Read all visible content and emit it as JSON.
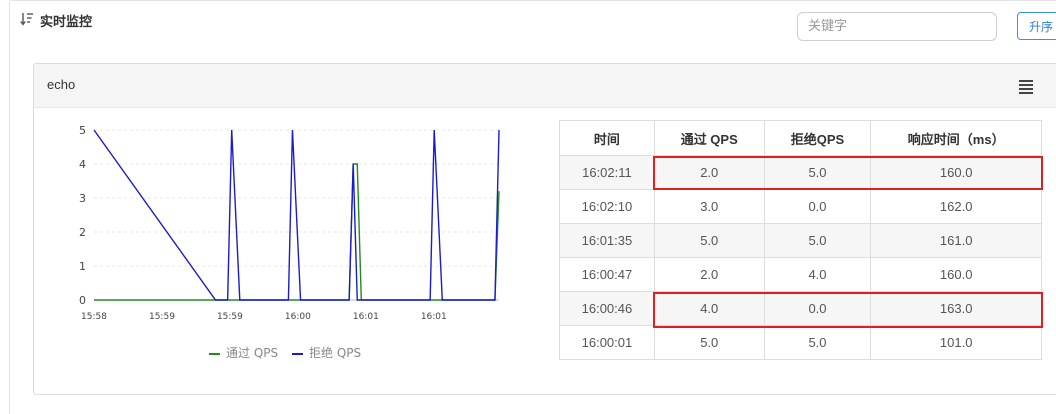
{
  "header": {
    "title": "实时监控",
    "sort_icon": "sort-descending-icon"
  },
  "search": {
    "placeholder": "关键字"
  },
  "sort_button": {
    "label": "升序"
  },
  "card": {
    "title": "echo",
    "menu_icon": "hamburger-menu-icon"
  },
  "table": {
    "columns": [
      "时间",
      "通过 QPS",
      "拒绝QPS",
      "响应时间（ms）"
    ],
    "rows": [
      [
        "16:02:11",
        "2.0",
        "5.0",
        "160.0"
      ],
      [
        "16:02:10",
        "3.0",
        "0.0",
        "162.0"
      ],
      [
        "16:01:35",
        "5.0",
        "5.0",
        "161.0"
      ],
      [
        "16:00:47",
        "2.0",
        "4.0",
        "160.0"
      ],
      [
        "16:00:46",
        "4.0",
        "0.0",
        "163.0"
      ],
      [
        "16:00:01",
        "5.0",
        "5.0",
        "101.0"
      ]
    ],
    "highlighted_rows": [
      0,
      4
    ],
    "highlight_color": "#e02020"
  },
  "chart_data": {
    "type": "line",
    "x_tick_labels": [
      "15:58",
      "15:59",
      "15:59",
      "16:00",
      "16:01",
      "16:01"
    ],
    "y_tick_labels": [
      "0",
      "1",
      "2",
      "3",
      "4",
      "5"
    ],
    "ylim": [
      0,
      5
    ],
    "x": [
      0,
      0.3,
      0.33,
      0.34,
      0.36,
      0.45,
      0.48,
      0.49,
      0.51,
      0.6,
      0.63,
      0.64,
      0.65,
      0.66,
      0.8,
      0.83,
      0.84,
      0.86,
      0.96,
      0.99,
      1.0
    ],
    "series": [
      {
        "name": "通过 QPS",
        "color": "#228b22",
        "values": [
          0,
          0,
          0,
          0,
          0,
          0,
          0,
          0,
          0,
          0,
          0,
          4.0,
          4.0,
          0,
          0,
          0,
          0,
          0,
          0,
          0,
          3.2
        ]
      },
      {
        "name": "拒绝 QPS",
        "color": "#1c1ccc",
        "values": [
          5,
          0,
          0,
          5,
          0,
          0,
          0,
          5,
          0,
          0,
          0,
          4.0,
          0,
          0,
          0,
          0,
          5,
          0,
          0,
          0,
          5
        ]
      }
    ],
    "grid": true,
    "legend": "bottom"
  }
}
